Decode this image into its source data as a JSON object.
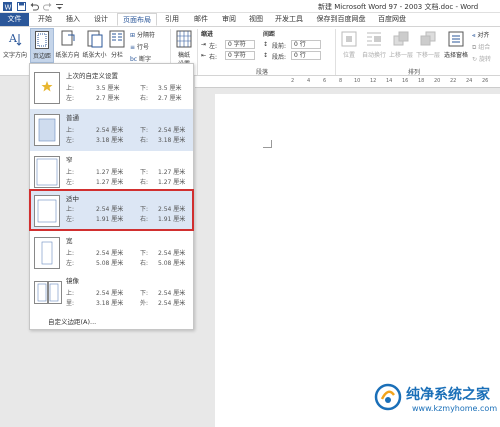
{
  "window": {
    "title": "新建 Microsoft Word 97 - 2003 文档.doc - Word"
  },
  "quick_access": {
    "icons": [
      "word-logo-icon",
      "save-icon",
      "undo-icon",
      "redo-icon",
      "customize-icon"
    ]
  },
  "tabs": [
    {
      "label": "文件"
    },
    {
      "label": "开始"
    },
    {
      "label": "插入"
    },
    {
      "label": "设计"
    },
    {
      "label": "页面布局"
    },
    {
      "label": "引用"
    },
    {
      "label": "邮件"
    },
    {
      "label": "审阅"
    },
    {
      "label": "视图"
    },
    {
      "label": "开发工具"
    },
    {
      "label": "保存到百度网盘"
    },
    {
      "label": "百度网盘"
    }
  ],
  "ribbon": {
    "page_setup": {
      "text_direction": "文字方向",
      "margins": "页边距",
      "orientation": "纸张方向",
      "size": "纸张大小",
      "columns": "分栏",
      "breaks": "分隔符",
      "line_numbers": "行号",
      "hyphenation": "断字"
    },
    "manuscript": {
      "label_top": "稿纸",
      "label_bottom": "设置"
    },
    "paragraph": {
      "indent_label": "缩进",
      "spacing_label": "间距",
      "left_label": "左:",
      "left_value": "0 字符",
      "right_label": "右:",
      "right_value": "0 字符",
      "before_label": "段前:",
      "before_value": "0 行",
      "after_label": "段后:",
      "after_value": "0 行",
      "group_label": "段落"
    },
    "arrange": {
      "position": "位置",
      "wrap_text": "自动换行",
      "bring_forward": "上移一层",
      "send_backward": "下移一层",
      "selection_pane": "选择窗格",
      "align": "对齐",
      "group": "组合",
      "rotate": "旋转",
      "group_label": "排列"
    }
  },
  "ruler": {
    "marks": [
      "2",
      "4",
      "6",
      "8",
      "10",
      "12",
      "14",
      "16",
      "18",
      "20",
      "22",
      "24",
      "26"
    ]
  },
  "margins_menu": {
    "items": [
      {
        "name": "上次的自定义设置",
        "k1": "上:",
        "v1": "3.5 厘米",
        "k2": "下:",
        "v2": "3.5 厘米",
        "k3": "左:",
        "v3": "2.7 厘米",
        "k4": "右:",
        "v4": "2.7 厘米"
      },
      {
        "name": "普通",
        "k1": "上:",
        "v1": "2.54 厘米",
        "k2": "下:",
        "v2": "2.54 厘米",
        "k3": "左:",
        "v3": "3.18 厘米",
        "k4": "右:",
        "v4": "3.18 厘米"
      },
      {
        "name": "窄",
        "k1": "上:",
        "v1": "1.27 厘米",
        "k2": "下:",
        "v2": "1.27 厘米",
        "k3": "左:",
        "v3": "1.27 厘米",
        "k4": "右:",
        "v4": "1.27 厘米"
      },
      {
        "name": "适中",
        "k1": "上:",
        "v1": "2.54 厘米",
        "k2": "下:",
        "v2": "2.54 厘米",
        "k3": "左:",
        "v3": "1.91 厘米",
        "k4": "右:",
        "v4": "1.91 厘米"
      },
      {
        "name": "宽",
        "k1": "上:",
        "v1": "2.54 厘米",
        "k2": "下:",
        "v2": "2.54 厘米",
        "k3": "左:",
        "v3": "5.08 厘米",
        "k4": "右:",
        "v4": "5.08 厘米"
      },
      {
        "name": "镜像",
        "k1": "上:",
        "v1": "2.54 厘米",
        "k2": "下:",
        "v2": "2.54 厘米",
        "k3": "里:",
        "v3": "3.18 厘米",
        "k4": "外:",
        "v4": "2.54 厘米"
      }
    ],
    "custom_label": "自定义边距(A)..."
  },
  "watermark": {
    "title": "纯净系统之家",
    "url": "www.kzmyhome.com"
  },
  "colors": {
    "brand": "#2b579a",
    "highlight": "#d12f2f",
    "selected_bg": "#dce6f4"
  }
}
